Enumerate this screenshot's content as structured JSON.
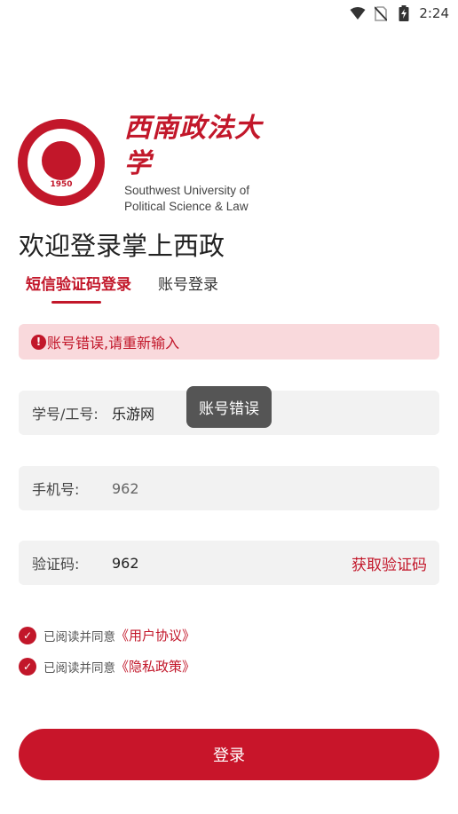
{
  "status_bar": {
    "time": "2:24",
    "icons": [
      "wifi-icon",
      "no-sim-icon",
      "battery-charging-icon"
    ]
  },
  "logo": {
    "name_cn": "西南政法大学",
    "name_en_line1": "Southwest University of",
    "name_en_line2": "Political Science & Law",
    "emblem_year": "1950"
  },
  "welcome_title": "欢迎登录掌上西政",
  "tabs": [
    {
      "label": "短信验证码登录",
      "active": true
    },
    {
      "label": "账号登录",
      "active": false
    }
  ],
  "alert": {
    "icon": "!",
    "message": "账号错误,请重新输入"
  },
  "fields": {
    "id": {
      "label": "学号/工号:",
      "value": "乐游网"
    },
    "phone": {
      "label": "手机号:",
      "value": "962"
    },
    "code": {
      "label": "验证码:",
      "value": "962",
      "action": "获取验证码"
    }
  },
  "toast": "账号错误",
  "agreements": [
    {
      "prefix": "已阅读并同意",
      "link": "《用户协议》",
      "checked": true
    },
    {
      "prefix": "已阅读并同意",
      "link": "《隐私政策》",
      "checked": true
    }
  ],
  "login_button": "登录",
  "colors": {
    "accent": "#c2172a",
    "alert_bg": "#f9d9dc",
    "field_bg": "#f2f2f2"
  }
}
